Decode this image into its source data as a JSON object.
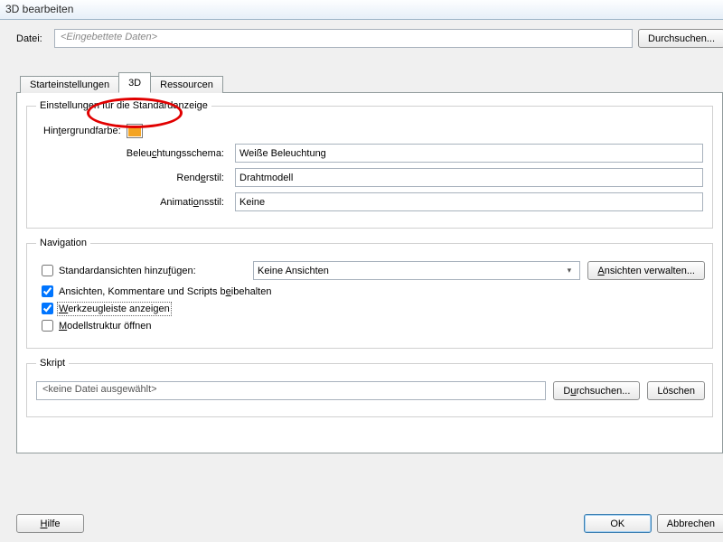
{
  "window": {
    "title": "3D bearbeiten"
  },
  "file": {
    "label": "Datei:",
    "value": "<Eingebettete Daten>",
    "browse": "Durchsuchen..."
  },
  "tabs": {
    "start": "Starteinstellungen",
    "threeD": "3D",
    "resources": "Ressourcen"
  },
  "defaults": {
    "legend": "Einstellungen für die Standardanzeige",
    "bgcolor_label": "Hintergrundfarbe:",
    "bgcolor": "#f4a423",
    "lighting_label": "Beleuchtungsschema:",
    "lighting_value": "Weiße Beleuchtung",
    "render_label": "Renderstil:",
    "render_value": "Drahtmodell",
    "anim_label": "Animationsstil:",
    "anim_value": "Keine"
  },
  "nav": {
    "legend": "Navigation",
    "addviews_label": "Standardansichten hinzufügen:",
    "addviews_checked": false,
    "views_value": "Keine Ansichten",
    "manage_views": "Ansichten verwalten...",
    "keep_label": "Ansichten, Kommentare und Scripts beibehalten",
    "keep_checked": true,
    "toolbar_label": "Werkzeugleiste anzeigen",
    "toolbar_checked": true,
    "modeltree_label": "Modellstruktur öffnen",
    "modeltree_checked": false
  },
  "script": {
    "legend": "Skript",
    "value": "<keine Datei ausgewählt>",
    "browse": "Durchsuchen...",
    "clear": "Löschen"
  },
  "footer": {
    "help": "Hilfe",
    "ok": "OK",
    "cancel": "Abbrechen"
  }
}
